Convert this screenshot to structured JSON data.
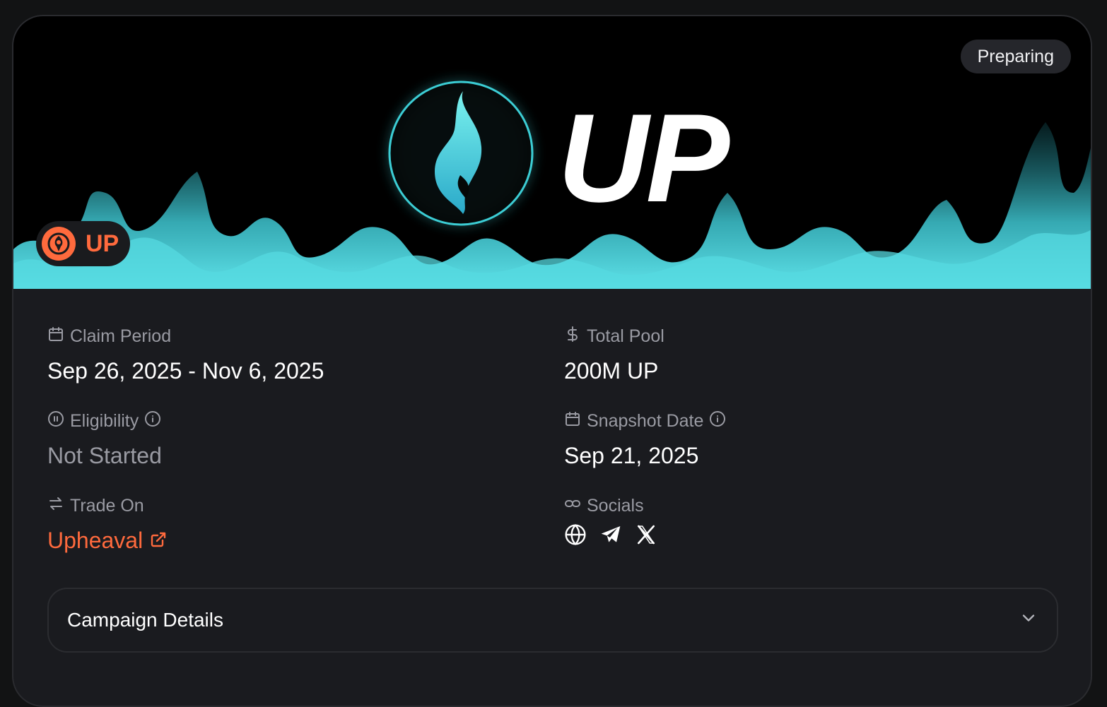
{
  "status": "Preparing",
  "token": {
    "symbol": "UP",
    "banner_text": "UP"
  },
  "fields": {
    "claim_period": {
      "label": "Claim Period",
      "value": "Sep 26, 2025 - Nov 6, 2025"
    },
    "total_pool": {
      "label": "Total Pool",
      "value": "200M UP"
    },
    "eligibility": {
      "label": "Eligibility",
      "value": "Not Started"
    },
    "snapshot_date": {
      "label": "Snapshot Date",
      "value": "Sep 21, 2025"
    },
    "trade_on": {
      "label": "Trade On",
      "value": "Upheaval"
    },
    "socials": {
      "label": "Socials",
      "icons": [
        "globe-icon",
        "telegram-icon",
        "x-icon"
      ]
    }
  },
  "campaign_details": {
    "label": "Campaign Details"
  },
  "colors": {
    "accent": "#ff6a3d",
    "flame": "#4fd3dc",
    "background": "#1a1b1f",
    "muted": "#9a9ba3"
  }
}
